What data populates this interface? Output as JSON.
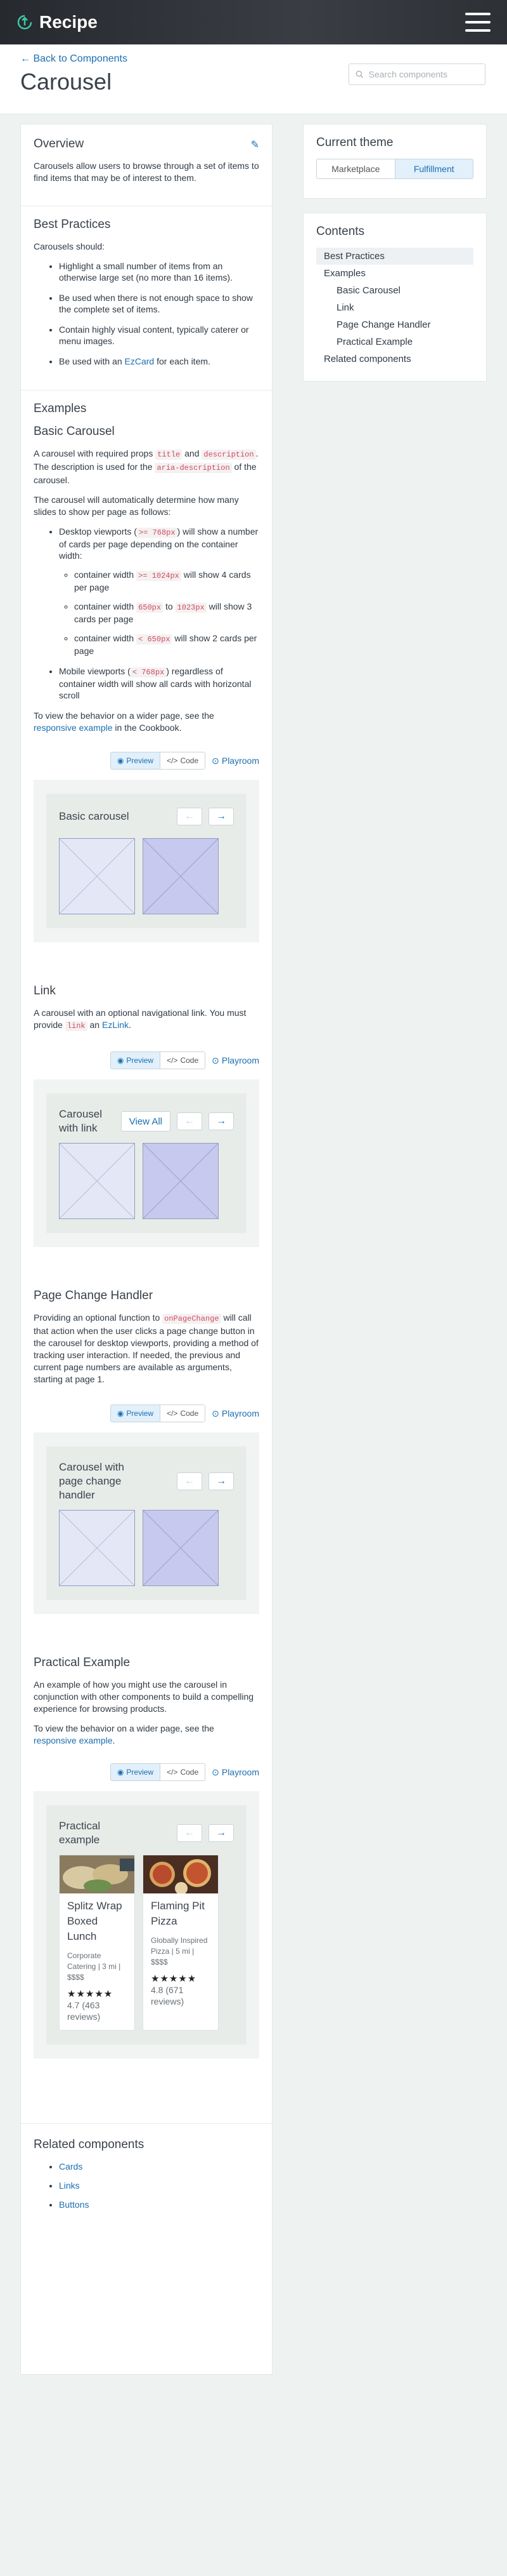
{
  "app": {
    "name": "Recipe"
  },
  "header": {
    "back_label": "← Back to Components",
    "title": "Carousel",
    "search_placeholder": "Search components"
  },
  "overview": {
    "heading": "Overview",
    "text": "Carousels allow users to browse through a set of items to find items that may be of interest to them."
  },
  "best_practices": {
    "heading": "Best Practices",
    "intro": "Carousels should:",
    "items": [
      "Highlight a small number of items from an otherwise large set (no more than 16 items).",
      "Be used when there is not enough space to show the complete set of items.",
      "Contain highly visual content, typically caterer or menu images."
    ],
    "ezcard_prefix": "Be used with an ",
    "ezcard_link": "EzCard",
    "ezcard_suffix": " for each item."
  },
  "examples": {
    "heading": "Examples",
    "basic": {
      "heading": "Basic Carousel",
      "p1_a": "A carousel with required props ",
      "p1_code1": "title",
      "p1_b": " and ",
      "p1_code2": "description",
      "p1_c": ". The description is used for the ",
      "p1_code3": "aria-description",
      "p1_d": " of the carousel.",
      "p2": "The carousel will automatically determine how many slides to show per page as follows:",
      "desktop_a": "Desktop viewports (",
      "desktop_code": ">= 768px",
      "desktop_b": ") will show a number of cards per page depending on the container width:",
      "w1_a": "container width ",
      "w1_code": ">= 1024px",
      "w1_b": " will show 4 cards per page",
      "w2_a": "container width ",
      "w2_code1": "650px",
      "w2_b": " to ",
      "w2_code2": "1023px",
      "w2_c": " will show 3 cards per page",
      "w3_a": "container width ",
      "w3_code": "< 650px",
      "w3_b": " will show 2 cards per page",
      "mobile_a": "Mobile viewports (",
      "mobile_code": "< 768px",
      "mobile_b": ") regardless of container width will show all cards with horizontal scroll",
      "p3_a": "To view the behavior on a wider page, see the ",
      "p3_link": "responsive example",
      "p3_b": " in the Cookbook.",
      "carousel_title": "Basic carousel"
    },
    "link": {
      "heading": "Link",
      "p_a": "A carousel with an optional navigational link. You must provide ",
      "p_code": "link",
      "p_b": " an ",
      "p_link": "EzLink",
      "p_c": ".",
      "carousel_title": "Carousel with link",
      "view_all": "View All"
    },
    "page_change": {
      "heading": "Page Change Handler",
      "p_a": "Providing an optional function to ",
      "p_code": "onPageChange",
      "p_b": " will call that action when the user clicks a page change button in the carousel for desktop viewports, providing a method of tracking user interaction. If needed, the previous and current page numbers are available as arguments, starting at page 1.",
      "carousel_title": "Carousel with page change handler"
    },
    "practical": {
      "heading": "Practical Example",
      "p1": "An example of how you might use the carousel in conjunction with other components to build a compelling experience for browsing products.",
      "p2_a": "To view the behavior on a wider page, see the ",
      "p2_link": "responsive example",
      "p2_b": ".",
      "carousel_title": "Practical example",
      "cards": [
        {
          "name": "Splitz Wrap Boxed Lunch",
          "meta": "Corporate Catering | 3 mi | $$$$",
          "stars": "★★★★★",
          "rating": "4.7 (463 reviews)"
        },
        {
          "name": "Flaming Pit Pizza",
          "meta": "Globally Inspired Pizza | 5 mi | $$$$",
          "stars": "★★★★★",
          "rating": "4.8 (671 reviews)"
        }
      ]
    }
  },
  "example_toolbar": {
    "preview": "Preview",
    "code": "Code",
    "playroom": "Playroom"
  },
  "related": {
    "heading": "Related components",
    "items": [
      "Cards",
      "Links",
      "Buttons"
    ]
  },
  "theme": {
    "heading": "Current theme",
    "options": [
      "Marketplace",
      "Fulfillment"
    ],
    "selected": "Fulfillment"
  },
  "contents": {
    "heading": "Contents",
    "items": [
      "Best Practices",
      "Examples",
      "Basic Carousel",
      "Link",
      "Page Change Handler",
      "Practical Example",
      "Related components"
    ]
  }
}
